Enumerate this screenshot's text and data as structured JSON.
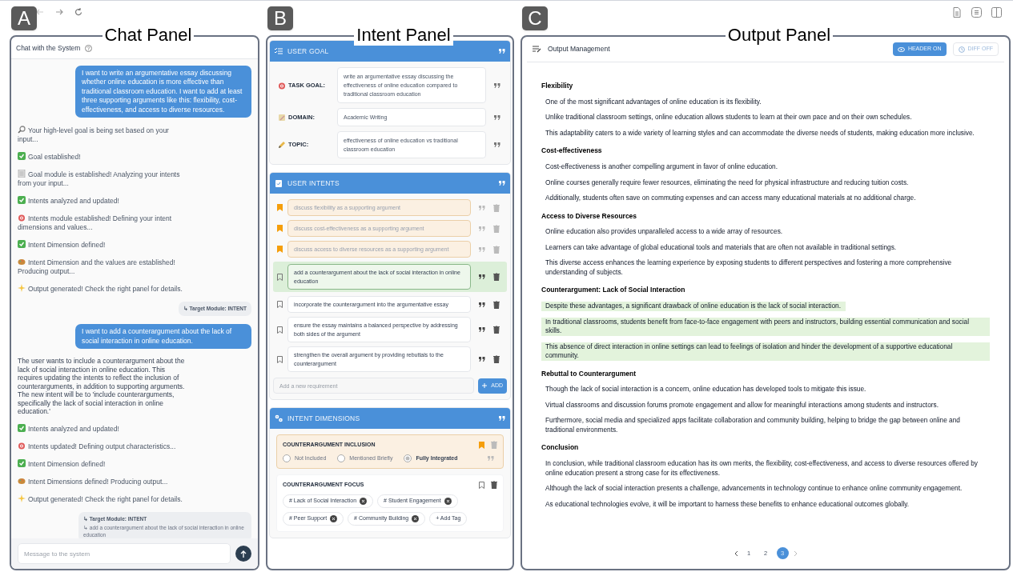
{
  "chat": {
    "badge": "A",
    "caption": "Chat Panel",
    "title": "Chat with the System",
    "messages": [
      {
        "kind": "user",
        "text": "I want to write an argumentative essay discussing whether online education is more effective than traditional classroom education. I want to add at least three supporting arguments like this: flexibility, cost-effectiveness, and access to diverse resources."
      },
      {
        "kind": "search",
        "text": "Your high-level goal is being set based on your input..."
      },
      {
        "kind": "done",
        "text": "Goal established!"
      },
      {
        "kind": "module",
        "text": "Goal module is established! Analyzing your intents from your input..."
      },
      {
        "kind": "done",
        "text": "Intents analyzed and updated!"
      },
      {
        "kind": "target",
        "text": "Intents module established! Defining your intent dimensions and values..."
      },
      {
        "kind": "done",
        "text": "Intent Dimension defined!"
      },
      {
        "kind": "paint",
        "text": "Intent Dimension and the values are established! Producing output..."
      },
      {
        "kind": "sparkle",
        "text": "Output generated! Check the right panel for details."
      },
      {
        "kind": "route",
        "module": "↳ Target Module: INTENT"
      },
      {
        "kind": "user",
        "text": "I want to add a counterargument about the lack of social interaction in online education."
      },
      {
        "kind": "reply",
        "text": "The user wants to include a counterargument about the lack of social interaction in online education. This requires updating the intents to reflect the inclusion of counterarguments, in addition to supporting arguments. The new intent will be to 'include counterarguments, specifically the lack of social interaction in online education.'"
      },
      {
        "kind": "done",
        "text": "Intents analyzed and updated!"
      },
      {
        "kind": "target",
        "text": "Intents updated! Defining output characteristics..."
      },
      {
        "kind": "done",
        "text": "Intent Dimension defined!"
      },
      {
        "kind": "paint",
        "text": "Intent Dimensions defined! Producing output..."
      },
      {
        "kind": "sparkle",
        "text": "Output generated! Check the right panel for details."
      },
      {
        "kind": "route",
        "module": "↳ Target Module: INTENT",
        "detail": "↳ add a counterargument about the lack of social interaction in online education"
      }
    ],
    "input": {
      "placeholder": "Message to the system"
    }
  },
  "intent": {
    "badge": "B",
    "caption": "Intent Panel",
    "goal": {
      "title": "USER GOAL",
      "fields": [
        {
          "kind": "target",
          "label": "TASK GOAL:",
          "value": "write an argumentative essay discussing the effectiveness of online education compared to traditional classroom education"
        },
        {
          "kind": "domain",
          "label": "DOMAIN:",
          "value": "Academic Writing"
        },
        {
          "kind": "topic",
          "label": "TOPIC:",
          "value": "effectiveness of online education vs traditional classroom education"
        }
      ]
    },
    "intents": {
      "title": "USER INTENTS",
      "items": [
        {
          "text": "discuss flexibility as a supporting argument",
          "pinned": true,
          "highlighted": false
        },
        {
          "text": "discuss cost-effectiveness as a supporting argument",
          "pinned": true,
          "highlighted": false
        },
        {
          "text": "discuss access to diverse resources as a supporting argument",
          "pinned": true,
          "highlighted": false
        },
        {
          "text": "add a counterargument about the lack of social interaction in online education",
          "pinned": false,
          "highlighted": true
        },
        {
          "text": "incorporate the counterargument into the argumentative essay",
          "pinned": false,
          "highlighted": false
        },
        {
          "text": "ensure the essay maintains a balanced perspective by addressing both sides of the argument",
          "pinned": false,
          "highlighted": false
        },
        {
          "text": "strengthen the overall argument by providing rebuttals to the counterargument",
          "pinned": false,
          "highlighted": false
        }
      ],
      "add": {
        "placeholder": "Add a new requirement",
        "button": "ADD"
      }
    },
    "dimensions": {
      "title": "INTENT DIMENSIONS",
      "items": [
        {
          "kind": "options",
          "title": "COUNTERARGUMENT INCLUSION",
          "pinned": true,
          "options": [
            {
              "label": "Not Included",
              "selected": false
            },
            {
              "label": "Mentioned Briefly",
              "selected": false
            },
            {
              "label": "Fully Integrated",
              "selected": true
            }
          ]
        },
        {
          "kind": "tags",
          "title": "COUNTERARGUMENT FOCUS",
          "pinned": false,
          "tags": [
            "# Lack of Social Interaction",
            "# Student Engagement",
            "# Peer Support",
            "# Community Building"
          ],
          "add_tag": "+ Add Tag"
        }
      ]
    }
  },
  "output": {
    "badge": "C",
    "caption": "Output Panel",
    "title": "Output Management",
    "toggles": [
      {
        "label": "HEADER ON",
        "on": true
      },
      {
        "label": "DIFF OFF",
        "on": false
      }
    ],
    "sections": [
      {
        "heading": "Flexibility",
        "paragraphs": [
          {
            "text": "One of the most significant advantages of online education is its flexibility.",
            "highlighted": false
          },
          {
            "text": "Unlike traditional classroom settings, online education allows students to learn at their own pace and on their own schedules.",
            "highlighted": false
          },
          {
            "text": "This adaptability caters to a wide variety of learning styles and can accommodate the diverse needs of students, making education more inclusive.",
            "highlighted": false
          }
        ]
      },
      {
        "heading": "Cost-effectiveness",
        "paragraphs": [
          {
            "text": "Cost-effectiveness is another compelling argument in favor of online education.",
            "highlighted": false
          },
          {
            "text": "Online courses generally require fewer resources, eliminating the need for physical infrastructure and reducing tuition costs.",
            "highlighted": false
          },
          {
            "text": "Additionally, students often save on commuting expenses and can access many educational materials at no additional charge.",
            "highlighted": false
          }
        ]
      },
      {
        "heading": "Access to Diverse Resources",
        "paragraphs": [
          {
            "text": "Online education also provides unparalleled access to a wide array of resources.",
            "highlighted": false
          },
          {
            "text": "Learners can take advantage of global educational tools and materials that are often not available in traditional settings.",
            "highlighted": false
          },
          {
            "text": "This diverse access enhances the learning experience by exposing students to different perspectives and fostering a more comprehensive understanding of subjects.",
            "highlighted": false
          }
        ]
      },
      {
        "heading": "Counterargument: Lack of Social Interaction",
        "paragraphs": [
          {
            "text": "Despite these advantages, a significant drawback of online education is the lack of social interaction.",
            "highlighted": true
          },
          {
            "text": "In traditional classrooms, students benefit from face-to-face engagement with peers and instructors, building essential communication and social skills.",
            "highlighted": true
          },
          {
            "text": "This absence of direct interaction in online settings can lead to feelings of isolation and hinder the development of a supportive educational community.",
            "highlighted": true
          }
        ]
      },
      {
        "heading": "Rebuttal to Counterargument",
        "paragraphs": [
          {
            "text": "Though the lack of social interaction is a concern, online education has developed tools to mitigate this issue.",
            "highlighted": false
          },
          {
            "text": "Virtual classrooms and discussion forums promote engagement and allow for meaningful interactions among students and instructors.",
            "highlighted": false
          },
          {
            "text": "Furthermore, social media and specialized apps facilitate collaboration and community building, helping to bridge the gap between online and traditional environments.",
            "highlighted": false
          }
        ]
      },
      {
        "heading": "Conclusion",
        "paragraphs": [
          {
            "text": "In conclusion, while traditional classroom education has its own merits, the flexibility, cost-effectiveness, and access to diverse resources offered by online education present a strong case for its effectiveness.",
            "highlighted": false
          },
          {
            "text": "Although the lack of social interaction presents a challenge, advancements in technology continue to enhance online community engagement.",
            "highlighted": false
          },
          {
            "text": "As educational technologies evolve, it will be important to harness these benefits to enhance educational outcomes globally.",
            "highlighted": false
          }
        ]
      }
    ],
    "pages": [
      {
        "label": "1",
        "selected": false
      },
      {
        "label": "2",
        "selected": false
      },
      {
        "label": "3",
        "selected": true
      }
    ]
  }
}
